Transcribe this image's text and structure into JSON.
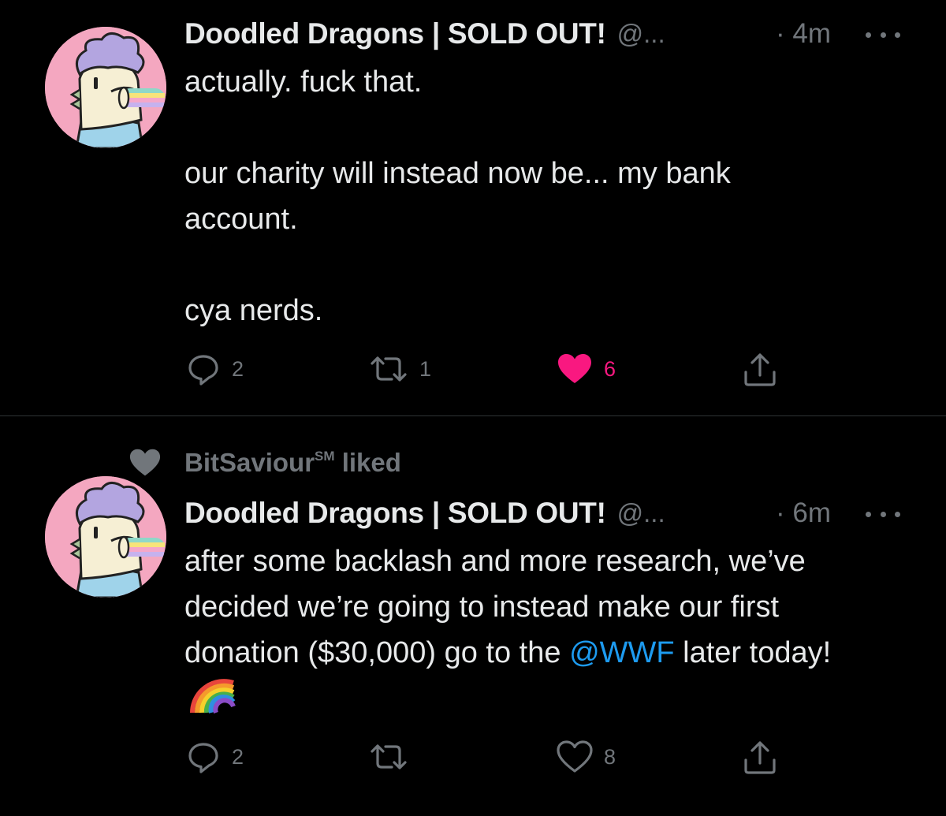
{
  "colors": {
    "background": "#000000",
    "text": "#e7e9ea",
    "secondary_text": "#71767b",
    "link": "#1d9bf0",
    "like": "#f91880",
    "avatar_bg": "#f4a7c0"
  },
  "tweets": [
    {
      "display_name": "Doodled Dragons | SOLD OUT!",
      "handle": "@...",
      "time": "· 4m",
      "body": [
        "actually. fuck that.",
        "our charity will instead now be... my bank account.",
        "cya nerds."
      ],
      "actions": {
        "reply_count": "2",
        "retweet_count": "1",
        "like_count": "6",
        "liked": true
      }
    },
    {
      "social_context": {
        "user": "BitSaviour",
        "user_mark": "SM",
        "action": "liked"
      },
      "display_name": "Doodled Dragons | SOLD OUT!",
      "handle": "@...",
      "time": "· 6m",
      "body_main": "after some backlash and more research, we’ve decided we’re going to instead make our first donation ($30,000) go to the",
      "mention": "@WWF",
      "body_tail": "later today!",
      "emoji": "rainbow",
      "actions": {
        "reply_count": "2",
        "retweet_count": "",
        "like_count": "8",
        "liked": false
      }
    }
  ],
  "icons": {
    "avatar": "doodled-dragon-avatar",
    "reply": "reply-bubble-icon",
    "retweet": "retweet-icon",
    "like": "heart-icon",
    "share": "share-icon",
    "more": "more-dots-icon",
    "social_context": "heart-icon"
  }
}
